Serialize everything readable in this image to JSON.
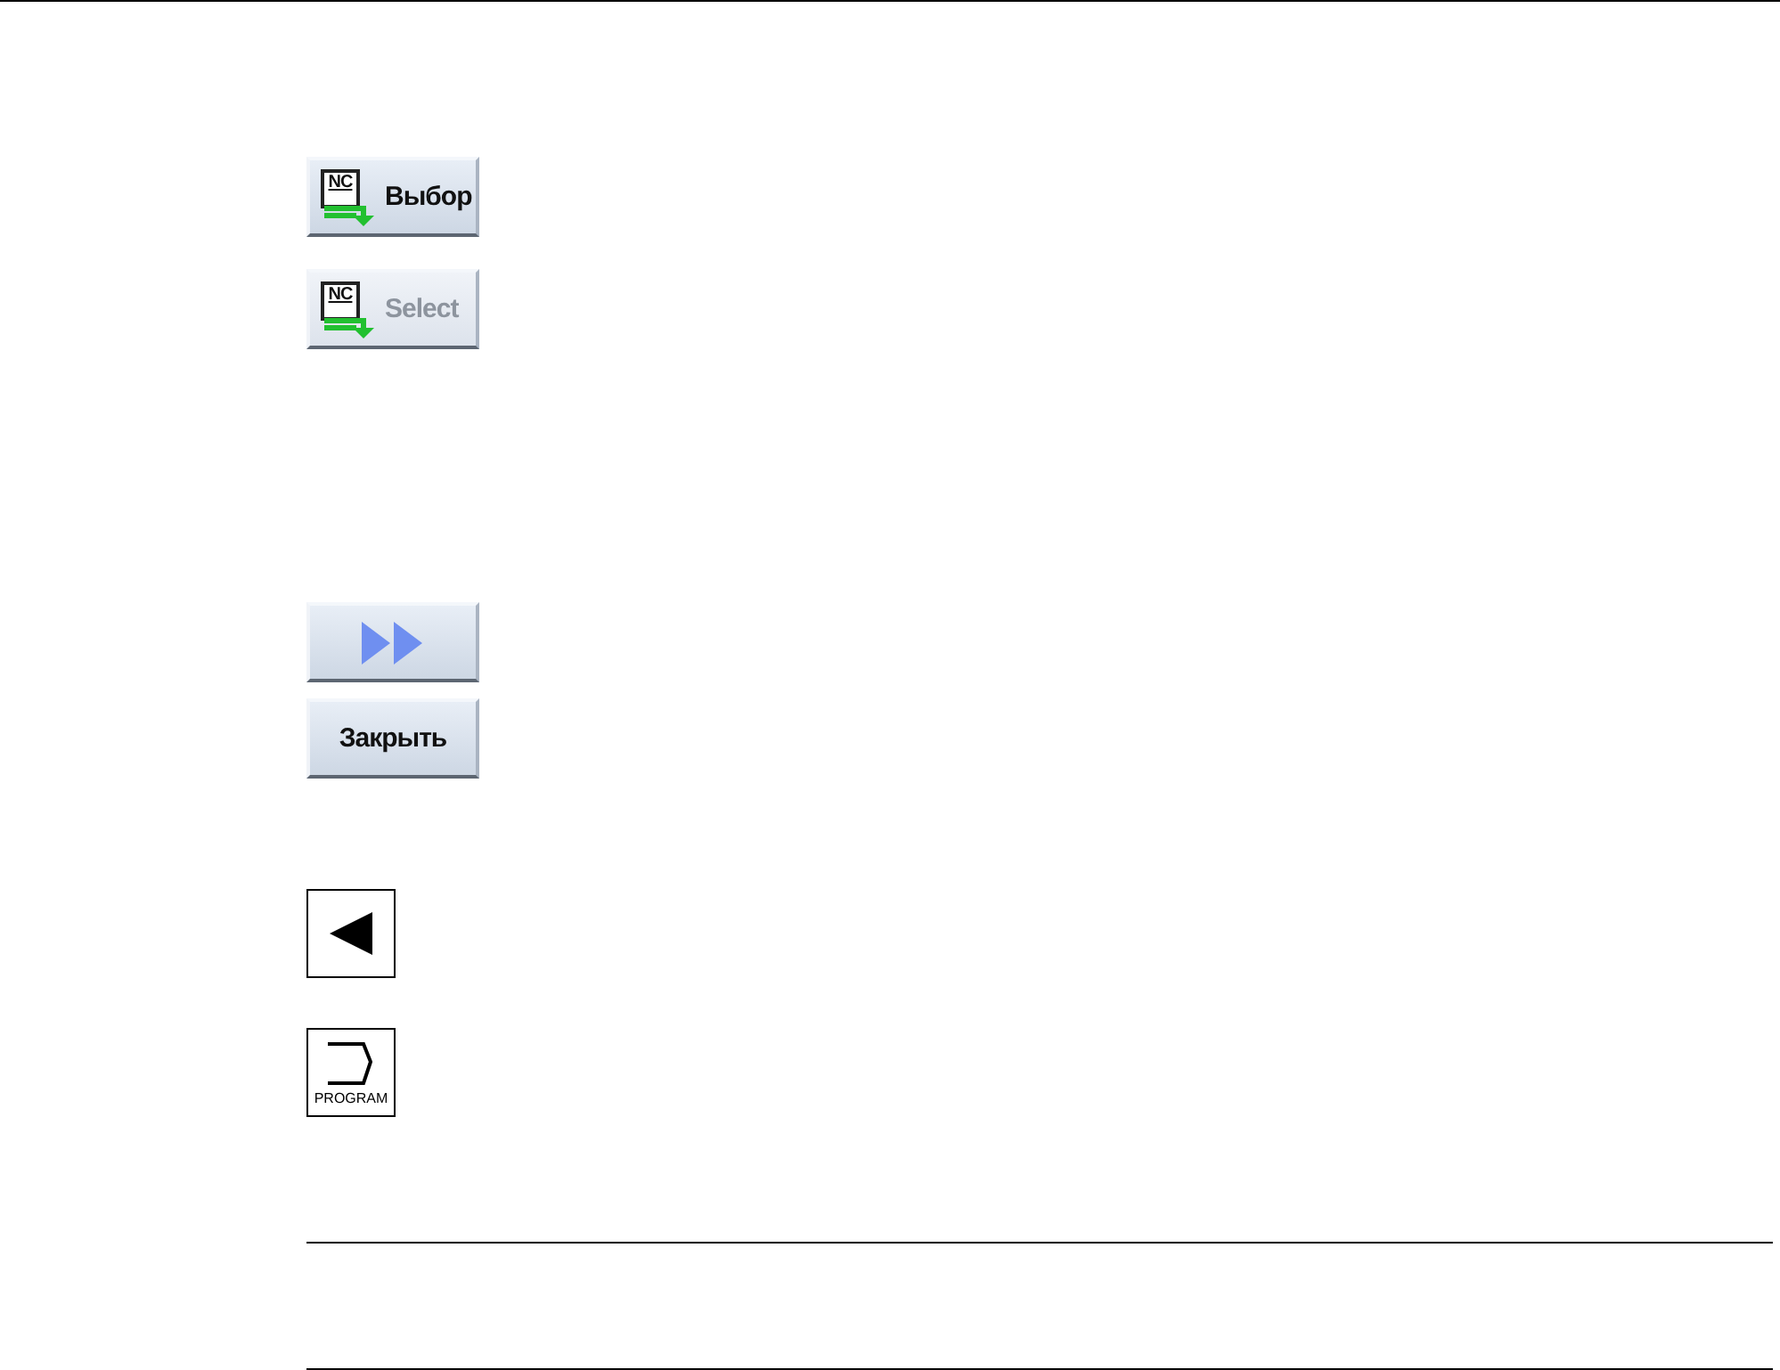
{
  "softkeys_top": [
    {
      "kind": "nc",
      "icon_text": "NC",
      "label": "Выбор",
      "disabled": false
    },
    {
      "kind": "nc",
      "icon_text": "NC",
      "label": "Select",
      "disabled": true
    }
  ],
  "softkeys_bottom": [
    {
      "kind": "forward"
    },
    {
      "kind": "text",
      "label": "Закрыть"
    }
  ],
  "keys": [
    {
      "kind": "back"
    },
    {
      "kind": "program",
      "label": "PROGRAM"
    }
  ]
}
